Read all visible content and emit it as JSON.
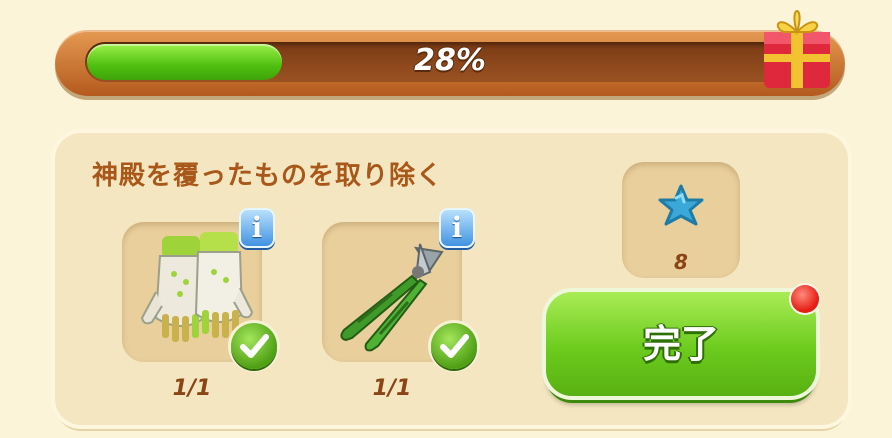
{
  "progress": {
    "value": 0.28,
    "label": "28%"
  },
  "task": {
    "title": "神殿を覆ったものを取り除く",
    "items": [
      {
        "name": "gloves",
        "count": "1/1",
        "done": true
      },
      {
        "name": "pruning-shears",
        "count": "1/1",
        "done": true
      }
    ],
    "reward": {
      "icon": "blue-star-icon",
      "count": "8"
    },
    "complete_label": "完了"
  },
  "colors": {
    "progress_green": "#4fbf10",
    "title_brown": "#a9581a",
    "button_green": "#6ccb1d"
  }
}
